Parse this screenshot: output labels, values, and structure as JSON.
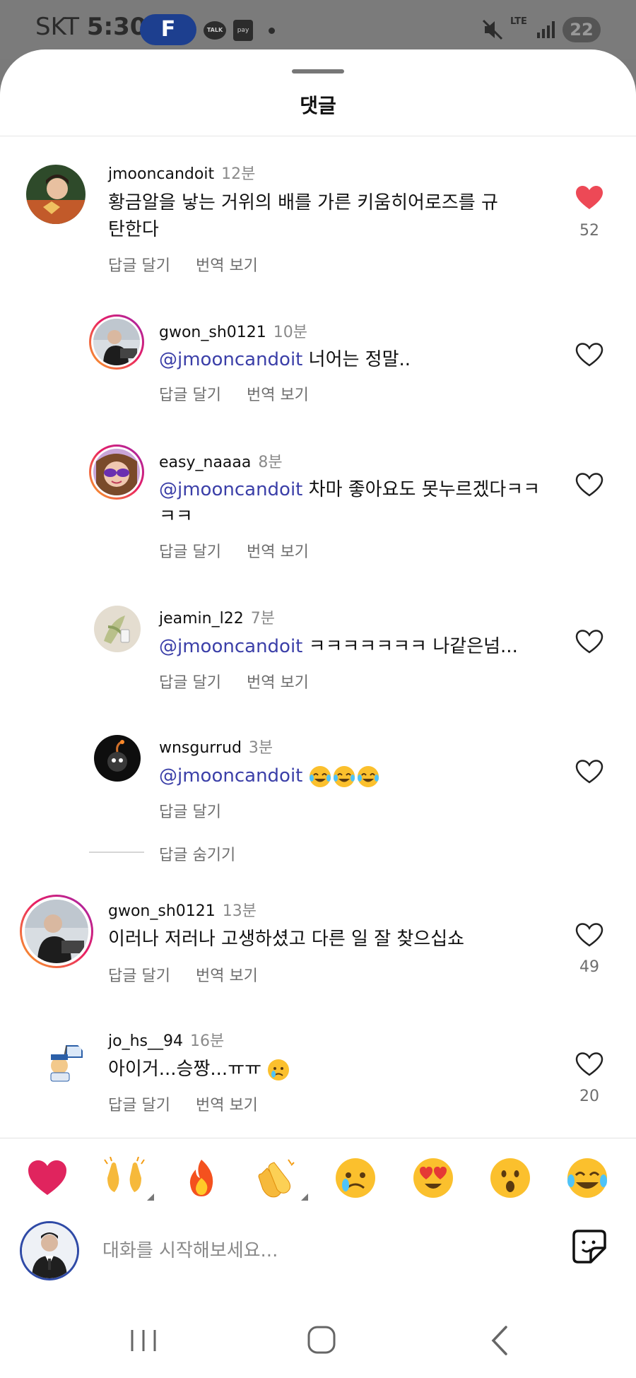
{
  "status_bar": {
    "carrier": "SKT",
    "time": "5:30",
    "app_badge": "F",
    "talk_icon_text": "TALK",
    "pay_icon_text": "pay",
    "network": "LTE",
    "battery": "22"
  },
  "sheet": {
    "title": "댓글"
  },
  "comments": [
    {
      "username": "jmooncandoit",
      "time": "12분",
      "text": "황금알을 낳는 거위의 배를 가른 키움히어로즈를 규탄한다",
      "reply_action": "답글 달기",
      "translate_action": "번역 보기",
      "liked": true,
      "like_count": "52"
    },
    {
      "username": "gwon_sh0121",
      "time": "10분",
      "mention": "@jmooncandoit",
      "text": "너어는 정말..",
      "reply_action": "답글 달기",
      "translate_action": "번역 보기"
    },
    {
      "username": "easy_naaaa",
      "time": "8분",
      "mention": "@jmooncandoit",
      "text": "차마 좋아요도 못누르겠다ㅋㅋㅋㅋ",
      "reply_action": "답글 달기",
      "translate_action": "번역 보기"
    },
    {
      "username": "jeamin_l22",
      "time": "7분",
      "mention": "@jmooncandoit",
      "text": "ㅋㅋㅋㅋㅋㅋㅋ 나같은넘...",
      "reply_action": "답글 달기",
      "translate_action": "번역 보기"
    },
    {
      "username": "wnsgurrud",
      "time": "3분",
      "mention": "@jmooncandoit",
      "emoji_count": 3,
      "reply_action": "답글 달기"
    },
    {
      "username": "gwon_sh0121",
      "time": "13분",
      "text": "이러나 저러나 고생하셨고 다른 일 잘 찾으십쇼",
      "reply_action": "답글 달기",
      "translate_action": "번역 보기",
      "like_count": "49"
    },
    {
      "username": "jo_hs__94",
      "time": "16분",
      "text": "아이거...승짱...ㅠㅠ",
      "reply_action": "답글 달기",
      "translate_action": "번역 보기",
      "like_count": "20"
    }
  ],
  "hide_replies": "답글 숨기기",
  "reactions": [
    "heart",
    "raised-hands",
    "fire",
    "clapping-hands",
    "crying-face",
    "heart-eyes-face",
    "surprised-face",
    "tears-of-joy-face"
  ],
  "composer": {
    "placeholder": "대화를 시작해보세요..."
  },
  "colors": {
    "like_red": "#ed4956",
    "mention": "#3b3fa8",
    "secondary_text": "#6e6e6e",
    "ring_gradient": "#e91e63"
  },
  "nav": [
    "recent-apps",
    "home",
    "back"
  ]
}
